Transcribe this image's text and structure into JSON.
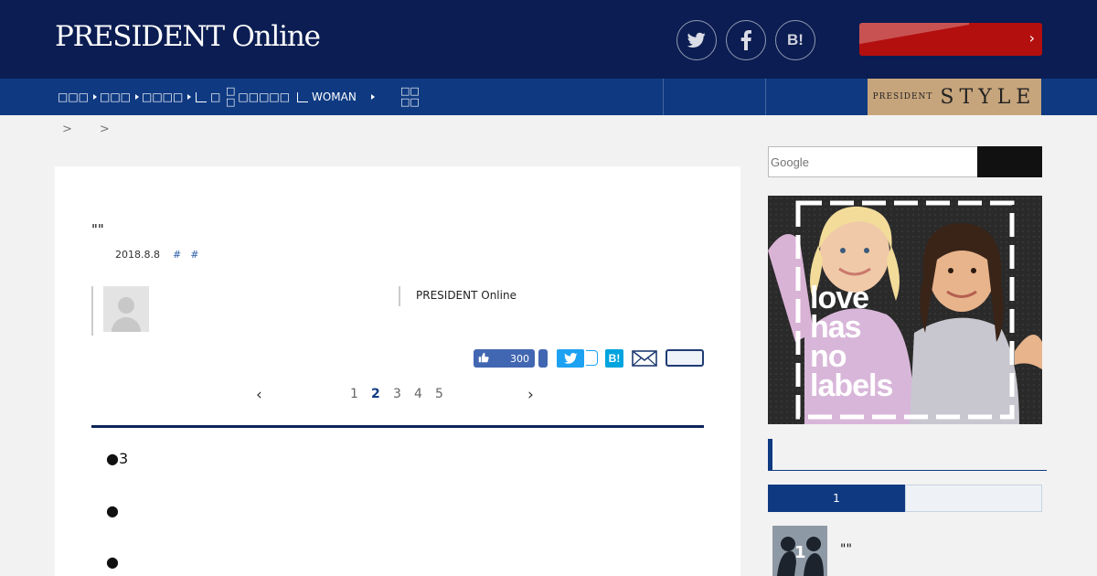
{
  "header": {
    "logo_text": "PRESIDENT Online",
    "hatena_label": "B!",
    "cta_chevron": "›"
  },
  "nav": {
    "items": [
      {
        "label": "□□□"
      },
      {
        "label": "□□□"
      },
      {
        "label": "□□□□"
      },
      {
        "label": "□"
      },
      {
        "label_top": "□",
        "label_bottom": "□",
        "label": "□□□□□"
      },
      {
        "label": "WOMAN"
      },
      {
        "label_top": "□□",
        "label_bottom": "□□"
      }
    ],
    "style_banner": {
      "small": "PRESIDENT",
      "big": "STYLE"
    }
  },
  "breadcrumb": {
    "items": [
      ">",
      ">"
    ]
  },
  "article": {
    "title": "\"\"",
    "date": "2018.8.8",
    "tags": [
      "#",
      "#"
    ],
    "author_source": "PRESIDENT Online",
    "like_count": "300",
    "pages": [
      "1",
      "2",
      "3",
      "4",
      "5"
    ],
    "current_page": "2",
    "toc": [
      "●3",
      "●",
      "●"
    ]
  },
  "sidebar": {
    "search_placeholder": "Google",
    "ad_text": [
      "love",
      "has",
      "no",
      "labels"
    ],
    "ranking": {
      "active_tab": "1",
      "items": [
        {
          "rank": "1",
          "title": "\"\""
        }
      ]
    }
  }
}
